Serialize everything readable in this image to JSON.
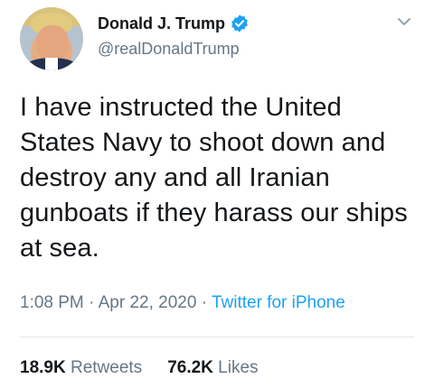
{
  "author": {
    "display_name": "Donald J. Trump",
    "handle": "@realDonaldTrump",
    "verified": true,
    "avatar_icon": "profile-photo"
  },
  "tweet": {
    "text": "I have instructed the United States Navy to shoot down and destroy any and all Iranian gunboats if they harass our ships at sea.",
    "time": "1:08 PM",
    "separator": "·",
    "date": "Apr 22, 2020",
    "source": "Twitter for iPhone"
  },
  "stats": {
    "retweets_count": "18.9K",
    "retweets_label": "Retweets",
    "likes_count": "76.2K",
    "likes_label": "Likes"
  },
  "colors": {
    "text": "#14171a",
    "secondary": "#657786",
    "accent": "#1da1f2",
    "divider": "#e1e8ed"
  },
  "icons": {
    "verified": "verified-badge-icon",
    "menu": "chevron-down-icon"
  }
}
